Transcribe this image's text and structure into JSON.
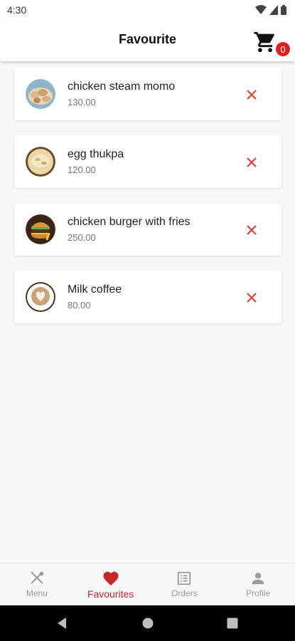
{
  "status_bar": {
    "time": "4:30"
  },
  "app_bar": {
    "title": "Favourite",
    "cart_count": "0"
  },
  "favourites": [
    {
      "name": "chicken steam momo",
      "price": "130.00",
      "icon": "momo-thumbnail"
    },
    {
      "name": "egg thukpa",
      "price": "120.00",
      "icon": "thukpa-thumbnail"
    },
    {
      "name": "chicken burger with fries",
      "price": "250.00",
      "icon": "burger-thumbnail"
    },
    {
      "name": "Milk coffee",
      "price": "80.00",
      "icon": "coffee-thumbnail"
    }
  ],
  "bottom_nav": [
    {
      "label": "Menu",
      "icon": "fork-knife-icon",
      "active": false
    },
    {
      "label": "Favourites",
      "icon": "heart-icon",
      "active": true
    },
    {
      "label": "Orders",
      "icon": "receipt-icon",
      "active": false
    },
    {
      "label": "Profile",
      "icon": "person-icon",
      "active": false
    }
  ],
  "colors": {
    "accent": "#c62828",
    "remove": "#e53935",
    "badge": "#e02020"
  }
}
